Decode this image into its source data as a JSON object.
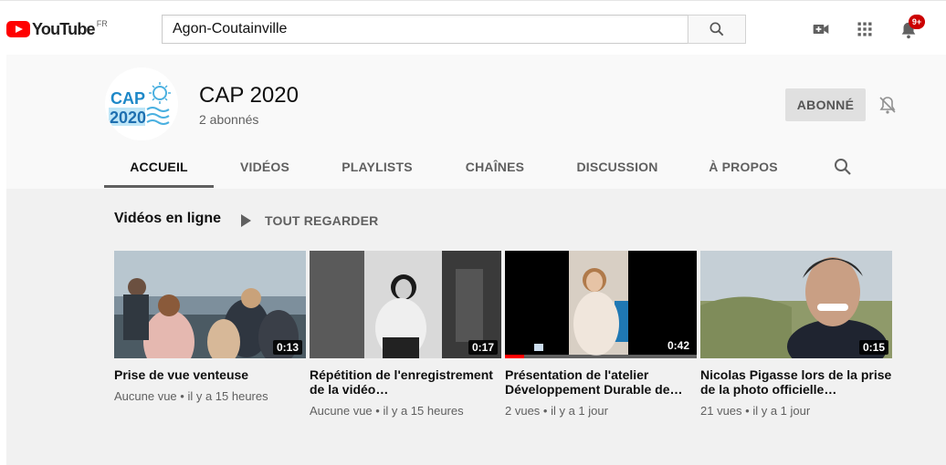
{
  "header": {
    "logo_text": "YouTube",
    "region": "FR",
    "search_value": "Agon-Coutainville",
    "notification_count": "9+"
  },
  "channel": {
    "avatar_text_line1": "CAP",
    "avatar_text_line2": "2020",
    "name": "CAP 2020",
    "subscribers": "2 abonnés",
    "subscribe_label": "ABONNÉ"
  },
  "tabs": [
    {
      "label": "ACCUEIL",
      "active": true
    },
    {
      "label": "VIDÉOS"
    },
    {
      "label": "PLAYLISTS"
    },
    {
      "label": "CHAÎNES"
    },
    {
      "label": "DISCUSSION"
    },
    {
      "label": "À PROPOS"
    }
  ],
  "section": {
    "title": "Vidéos en ligne",
    "play_all": "TOUT REGARDER"
  },
  "videos": [
    {
      "title": "Prise de vue venteuse",
      "duration": "0:13",
      "views": "Aucune vue",
      "age": "il y a 15 heures"
    },
    {
      "title": "Répétition de l'enregistrement de la vidéo…",
      "duration": "0:17",
      "views": "Aucune vue",
      "age": "il y a 15 heures"
    },
    {
      "title": "Présentation de l'atelier Développement Durable de…",
      "duration": "0:42",
      "views": "2 vues",
      "age": "il y a 1 jour",
      "progress": 0.1
    },
    {
      "title": "Nicolas Pigasse lors de la prise de la photo officielle…",
      "duration": "0:15",
      "views": "21 vues",
      "age": "il y a 1 jour"
    }
  ],
  "colors": {
    "brand_red": "#ff0000",
    "badge_red": "#cc0000",
    "avatar_blue": "#1e88c8"
  }
}
